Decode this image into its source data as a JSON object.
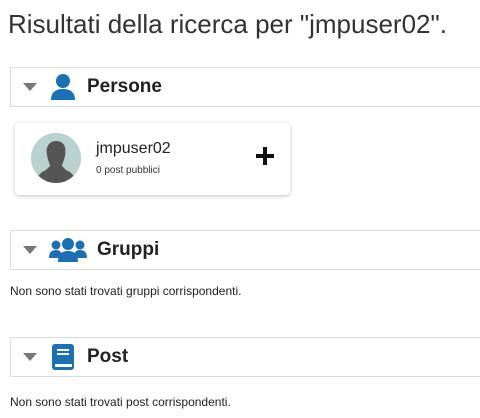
{
  "header": {
    "title": "Risultati della ricerca per  \"jmpuser02\"."
  },
  "sections": {
    "people": {
      "title": "Persone",
      "icon": "person-icon",
      "results": [
        {
          "name": "jmpuser02",
          "meta": "0 post pubblici"
        }
      ]
    },
    "groups": {
      "title": "Gruppi",
      "icon": "group-icon",
      "empty_message": "Non sono stati trovati gruppi corrispondenti."
    },
    "posts": {
      "title": "Post",
      "icon": "book-icon",
      "empty_message": "Non sono stati trovati post corrispondenti."
    }
  },
  "colors": {
    "accent": "#1a6fb5",
    "chevron": "#777777",
    "avatar_bg": "#b8d3cf",
    "avatar_fg": "#555555"
  }
}
